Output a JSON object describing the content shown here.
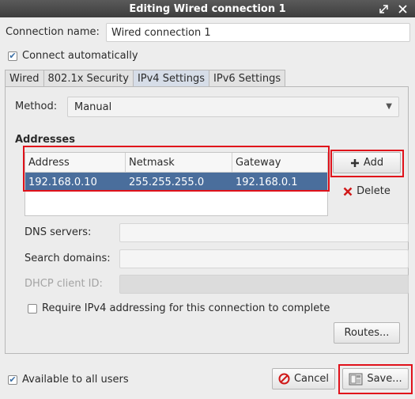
{
  "window": {
    "title": "Editing Wired connection 1"
  },
  "connection_name": {
    "label": "Connection name:",
    "value": "Wired connection 1"
  },
  "connect_automatically": {
    "label": "Connect automatically",
    "checked": true
  },
  "tabs": [
    {
      "label": "Wired"
    },
    {
      "label": "802.1x Security"
    },
    {
      "label": "IPv4 Settings",
      "active": true
    },
    {
      "label": "IPv6 Settings"
    }
  ],
  "method": {
    "label": "Method:",
    "value": "Manual"
  },
  "addresses": {
    "title": "Addresses",
    "columns": [
      "Address",
      "Netmask",
      "Gateway"
    ],
    "rows": [
      {
        "address": "192.168.0.10",
        "netmask": "255.255.255.0",
        "gateway": "192.168.0.1"
      }
    ],
    "add_label": "Add",
    "delete_label": "Delete"
  },
  "dns_servers": {
    "label": "DNS servers:",
    "value": ""
  },
  "search_domains": {
    "label": "Search domains:",
    "value": ""
  },
  "dhcp_client_id": {
    "label": "DHCP client ID:",
    "value": "",
    "disabled": true
  },
  "require_ipv4": {
    "label": "Require IPv4 addressing for this connection to complete",
    "checked": false
  },
  "routes_label": "Routes...",
  "available_all_users": {
    "label": "Available to all users",
    "checked": true
  },
  "cancel_label": "Cancel",
  "save_label": "Save...",
  "colors": {
    "selection": "#4a6e9c",
    "highlight_box": "#e0111a",
    "titlebar": "#3d3d3d"
  },
  "icons": [
    "maximize-icon",
    "close-icon",
    "plus-icon",
    "delete-x-icon",
    "cancel-icon",
    "save-icon"
  ]
}
